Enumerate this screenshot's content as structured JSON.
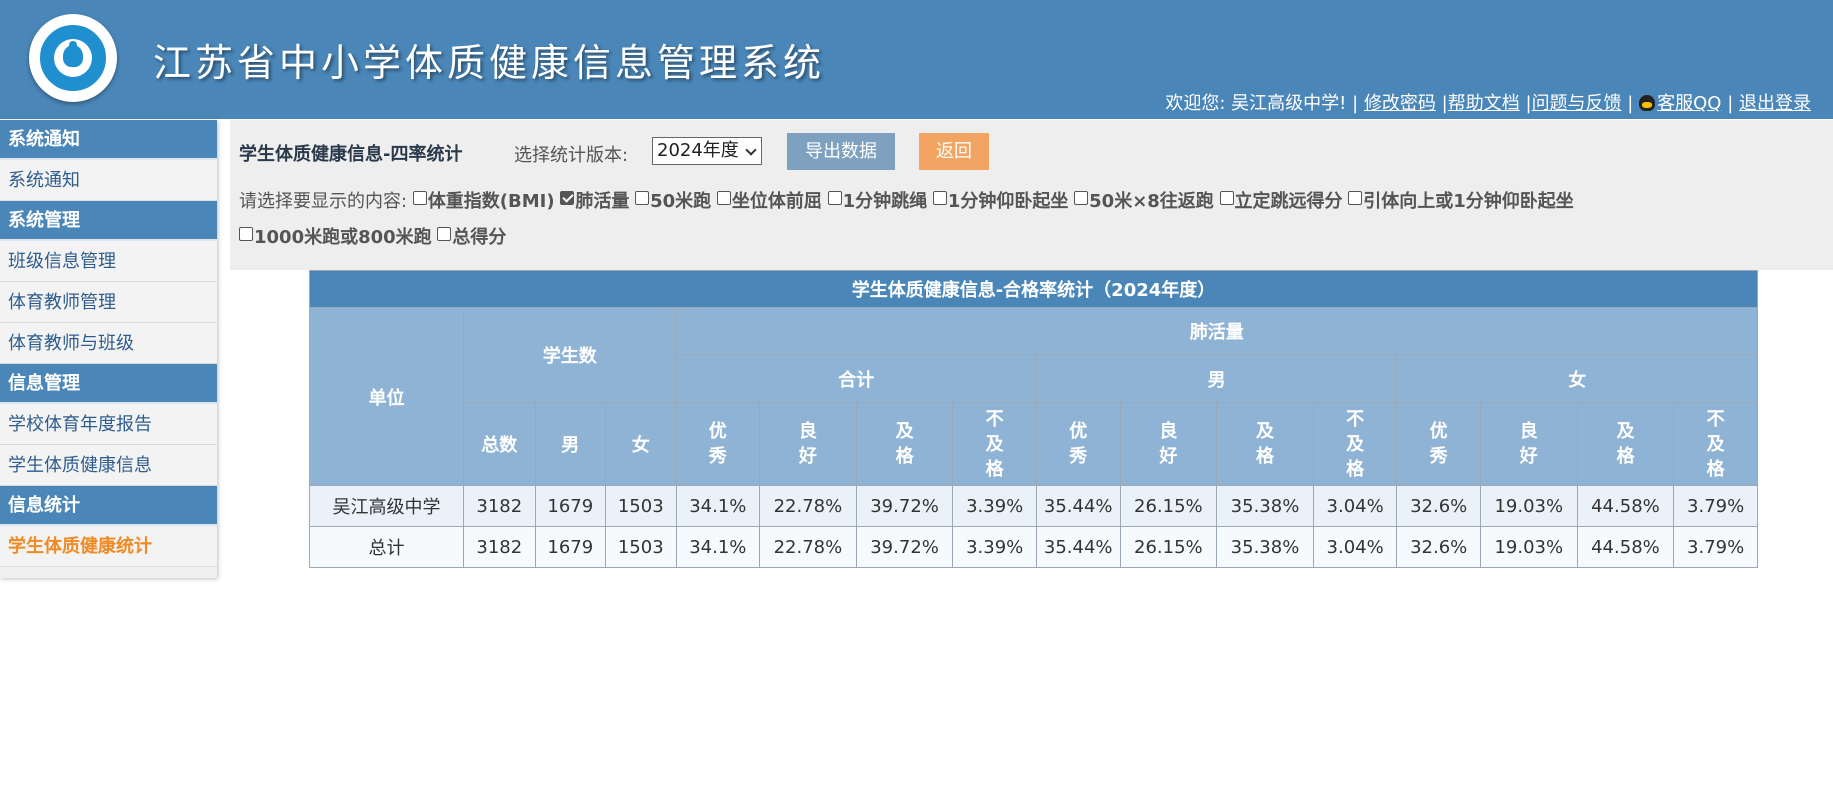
{
  "header": {
    "title": "江苏省中小学体质健康信息管理系统",
    "welcome": "欢迎您: 吴江高级中学!",
    "sep": "|",
    "links": {
      "change_password": "修改密码",
      "help": "帮助文档",
      "feedback": "问题与反馈",
      "qq": "客服QQ",
      "logout": "退出登录"
    }
  },
  "sidebar": {
    "sections": [
      {
        "title": "系统通知",
        "items": [
          "系统通知"
        ]
      },
      {
        "title": "系统管理",
        "items": [
          "班级信息管理",
          "体育教师管理",
          "体育教师与班级"
        ]
      },
      {
        "title": "信息管理",
        "items": [
          "学校体育年度报告",
          "学生体质健康信息"
        ]
      },
      {
        "title": "信息统计",
        "items": [
          "学生体质健康统计"
        ]
      }
    ]
  },
  "toolbar": {
    "title": "学生体质健康信息-四率统计",
    "version_label": "选择统计版本:",
    "version_selected": "2024年度",
    "export_label": "导出数据",
    "back_label": "返回",
    "choose_label": "请选择要显示的内容:",
    "options": [
      {
        "label": "体重指数(BMI)",
        "checked": false
      },
      {
        "label": "肺活量",
        "checked": true
      },
      {
        "label": "50米跑",
        "checked": false
      },
      {
        "label": "坐位体前屈",
        "checked": false
      },
      {
        "label": "1分钟跳绳",
        "checked": false
      },
      {
        "label": "1分钟仰卧起坐",
        "checked": false
      },
      {
        "label": "50米×8往返跑",
        "checked": false
      },
      {
        "label": "立定跳远得分",
        "checked": false
      },
      {
        "label": "引体向上或1分钟仰卧起坐",
        "checked": false
      },
      {
        "label": "1000米跑或800米跑",
        "checked": false
      },
      {
        "label": "总得分",
        "checked": false
      }
    ]
  },
  "table": {
    "caption": "学生体质健康信息-合格率统计（2024年度）",
    "unit_header": "单位",
    "students_header": "学生数",
    "metric_header": "肺活量",
    "group_headers": [
      "合计",
      "男",
      "女"
    ],
    "count_headers": [
      "总数",
      "男",
      "女"
    ],
    "grade_headers": [
      "优\n秀",
      "良\n好",
      "及\n格",
      "不\n及\n格"
    ],
    "rows": [
      {
        "unit": "吴江高级中学",
        "total": "3182",
        "male": "1679",
        "female": "1503",
        "all": [
          "34.1%",
          "22.78%",
          "39.72%",
          "3.39%"
        ],
        "boys": [
          "35.44%",
          "26.15%",
          "35.38%",
          "3.04%"
        ],
        "girls": [
          "32.6%",
          "19.03%",
          "44.58%",
          "3.79%"
        ]
      },
      {
        "unit": "总计",
        "total": "3182",
        "male": "1679",
        "female": "1503",
        "all": [
          "34.1%",
          "22.78%",
          "39.72%",
          "3.39%"
        ],
        "boys": [
          "35.44%",
          "26.15%",
          "35.38%",
          "3.04%"
        ],
        "girls": [
          "32.6%",
          "19.03%",
          "44.58%",
          "3.79%"
        ]
      }
    ]
  }
}
